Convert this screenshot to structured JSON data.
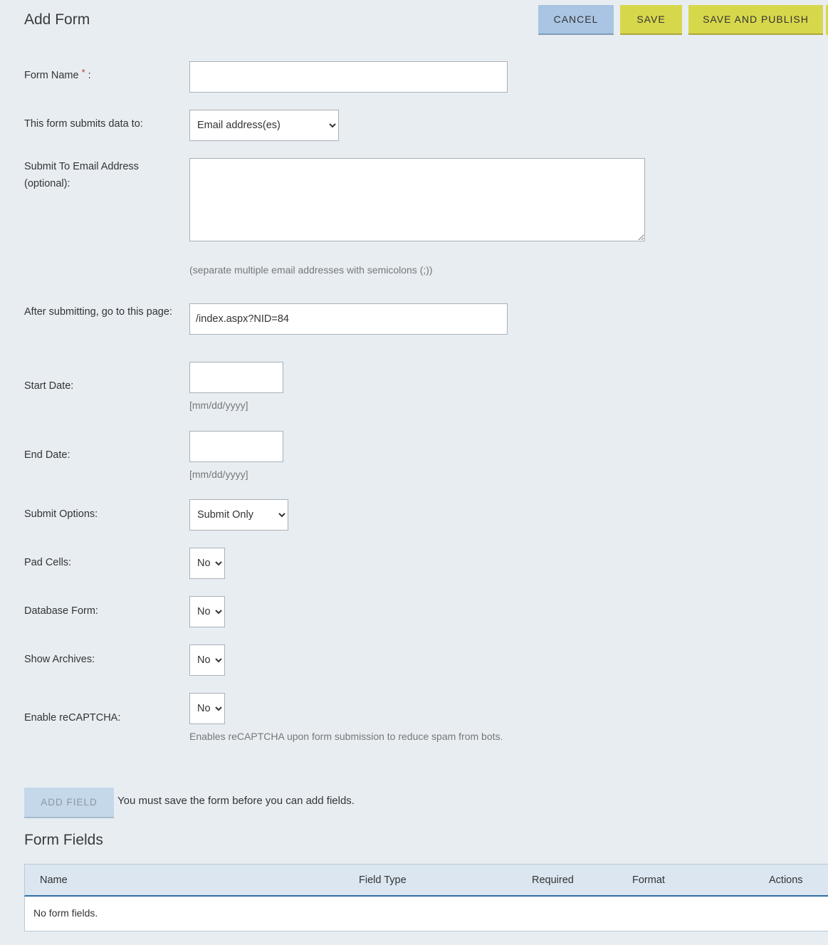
{
  "header": {
    "title": "Add Form",
    "cancel_label": "CANCEL",
    "save_label": "SAVE",
    "save_publish_label": "SAVE AND PUBLISH"
  },
  "form": {
    "form_name": {
      "label": "Form Name",
      "required_mark": "*",
      "suffix": ":",
      "value": ""
    },
    "submits_to": {
      "label": "This form submits data to:",
      "value": "Email address(es)"
    },
    "submit_email": {
      "label": "Submit To Email Address (optional):",
      "value": "",
      "hint": "(separate multiple email addresses with semicolons (;))"
    },
    "after_submit": {
      "label": "After submitting, go to this page:",
      "value": "/index.aspx?NID=84"
    },
    "start_date": {
      "label": "Start Date:",
      "value": "",
      "hint": "[mm/dd/yyyy]"
    },
    "end_date": {
      "label": "End Date:",
      "value": "",
      "hint": "[mm/dd/yyyy]"
    },
    "submit_options": {
      "label": "Submit Options:",
      "value": "Submit Only"
    },
    "pad_cells": {
      "label": "Pad Cells:",
      "value": "No"
    },
    "database_form": {
      "label": "Database Form:",
      "value": "No"
    },
    "show_archives": {
      "label": "Show Archives:",
      "value": "No"
    },
    "recaptcha": {
      "label": "Enable reCAPTCHA:",
      "value": "No",
      "hint": "Enables reCAPTCHA upon form submission to reduce spam from bots."
    }
  },
  "fields_section": {
    "add_field_label": "ADD FIELD",
    "add_field_note": "You must save the form before you can add fields.",
    "title": "Form Fields",
    "columns": [
      "Name",
      "Field Type",
      "Required",
      "Format",
      "Actions"
    ],
    "empty_message": "No form fields."
  },
  "colors": {
    "background": "#e8edf2",
    "cancel_button": "#a9c5e3",
    "save_button": "#d7d74c",
    "grid_header": "#dbe6f1",
    "grid_accent": "#2f6fa8",
    "required_mark": "#c0392b"
  }
}
